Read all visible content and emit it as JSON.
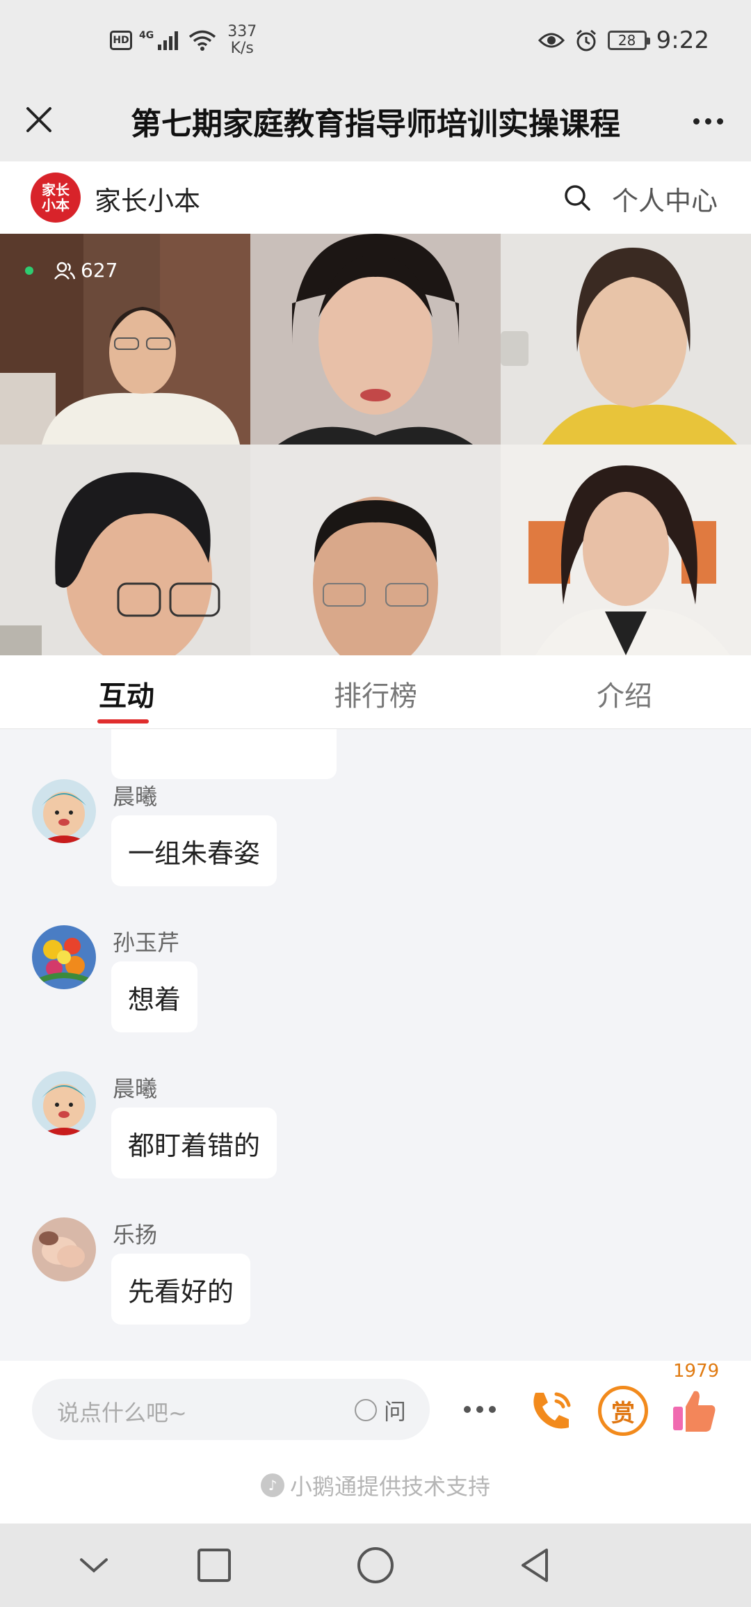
{
  "status_bar": {
    "hd": "HD",
    "network": "4G",
    "net_speed_value": "337",
    "net_speed_unit": "K/s",
    "battery": "28",
    "time": "9:22"
  },
  "header": {
    "title": "第七期家庭教育指导师培训实操课程"
  },
  "brand": {
    "logo_text": "家长小本",
    "name": "家长小本",
    "personal_center": "个人中心"
  },
  "video": {
    "viewer_count": "627"
  },
  "tabs": [
    {
      "label": "互动",
      "active": true
    },
    {
      "label": "排行榜",
      "active": false
    },
    {
      "label": "介绍",
      "active": false
    }
  ],
  "messages": [
    {
      "name": "晨曦",
      "text": "一组朱春姿",
      "avatar": "baby-avatar"
    },
    {
      "name": "孙玉芹",
      "text": "想着",
      "avatar": "flowers-avatar"
    },
    {
      "name": "晨曦",
      "text": "都盯着错的",
      "avatar": "baby-avatar"
    },
    {
      "name": "乐扬",
      "text": "先看好的",
      "avatar": "hands-avatar"
    }
  ],
  "input": {
    "placeholder": "说点什么吧~",
    "ask_label": "问"
  },
  "actions": {
    "reward_label": "赏",
    "like_count": "1979"
  },
  "footer": {
    "powered_by": "小鹅通提供技术支持"
  },
  "colors": {
    "accent_red": "#e02e2e",
    "brand_red": "#d8232a",
    "orange": "#f28a1c"
  }
}
